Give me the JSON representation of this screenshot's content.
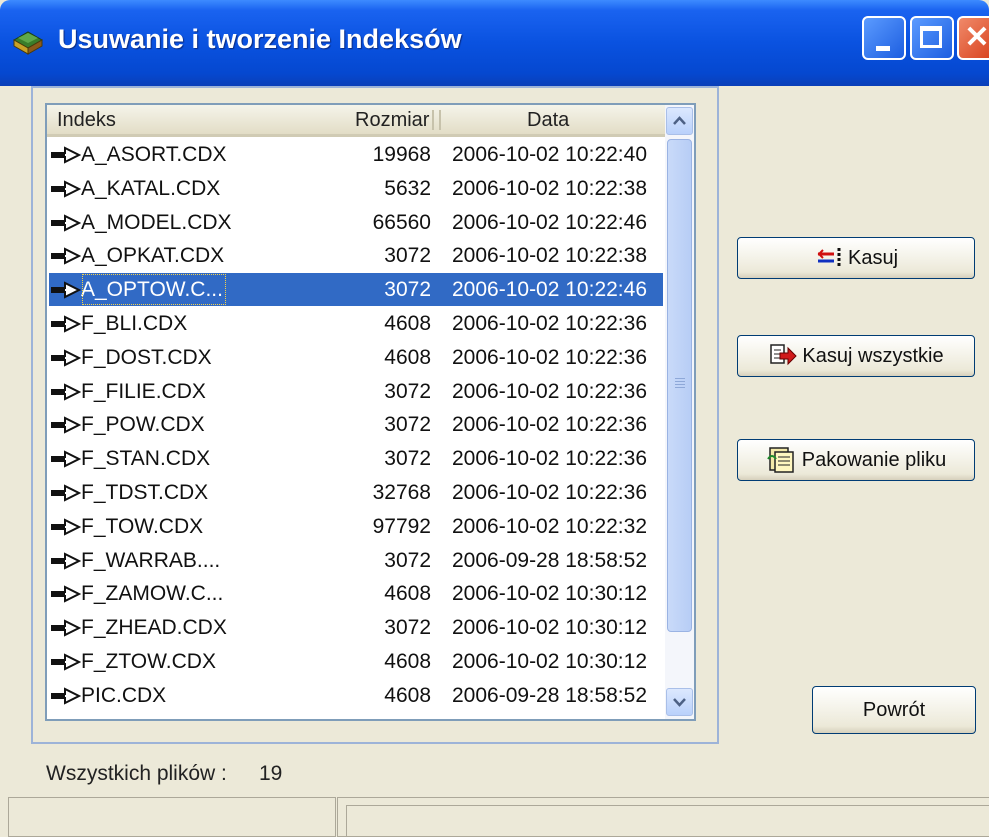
{
  "window": {
    "title": "Usuwanie i tworzenie Indeksów"
  },
  "list": {
    "columns": {
      "name": "Indeks",
      "size": "Rozmiar",
      "date": "Data"
    },
    "rows": [
      {
        "name": "A_ASORT.CDX",
        "size": "19968",
        "date": "2006-10-02 10:22:40"
      },
      {
        "name": "A_KATAL.CDX",
        "size": "5632",
        "date": "2006-10-02 10:22:38"
      },
      {
        "name": "A_MODEL.CDX",
        "size": "66560",
        "date": "2006-10-02 10:22:46"
      },
      {
        "name": "A_OPKAT.CDX",
        "size": "3072",
        "date": "2006-10-02 10:22:38"
      },
      {
        "name": "A_OPTOW.C...",
        "size": "3072",
        "date": "2006-10-02 10:22:46"
      },
      {
        "name": "F_BLI.CDX",
        "size": "4608",
        "date": "2006-10-02 10:22:36"
      },
      {
        "name": "F_DOST.CDX",
        "size": "4608",
        "date": "2006-10-02 10:22:36"
      },
      {
        "name": "F_FILIE.CDX",
        "size": "3072",
        "date": "2006-10-02 10:22:36"
      },
      {
        "name": "F_POW.CDX",
        "size": "3072",
        "date": "2006-10-02 10:22:36"
      },
      {
        "name": "F_STAN.CDX",
        "size": "3072",
        "date": "2006-10-02 10:22:36"
      },
      {
        "name": "F_TDST.CDX",
        "size": "32768",
        "date": "2006-10-02 10:22:36"
      },
      {
        "name": "F_TOW.CDX",
        "size": "97792",
        "date": "2006-10-02 10:22:32"
      },
      {
        "name": "F_WARRAB....",
        "size": "3072",
        "date": "2006-09-28 18:58:52"
      },
      {
        "name": "F_ZAMOW.C...",
        "size": "4608",
        "date": "2006-10-02 10:30:12"
      },
      {
        "name": "F_ZHEAD.CDX",
        "size": "3072",
        "date": "2006-10-02 10:30:12"
      },
      {
        "name": "F_ZTOW.CDX",
        "size": "4608",
        "date": "2006-10-02 10:30:12"
      },
      {
        "name": "PIC.CDX",
        "size": "4608",
        "date": "2006-09-28 18:58:52"
      }
    ],
    "selected_index": 4
  },
  "buttons": {
    "delete": "Kasuj",
    "delete_all": "Kasuj wszystkie",
    "pack": "Pakowanie pliku",
    "back": "Powrót"
  },
  "footer": {
    "files_label": "Wszystkich plików :",
    "files_count": "19"
  },
  "colors": {
    "titlebar": "#0a52e0",
    "selection": "#316ac5",
    "face": "#ece9d8",
    "close": "#d8401c"
  }
}
